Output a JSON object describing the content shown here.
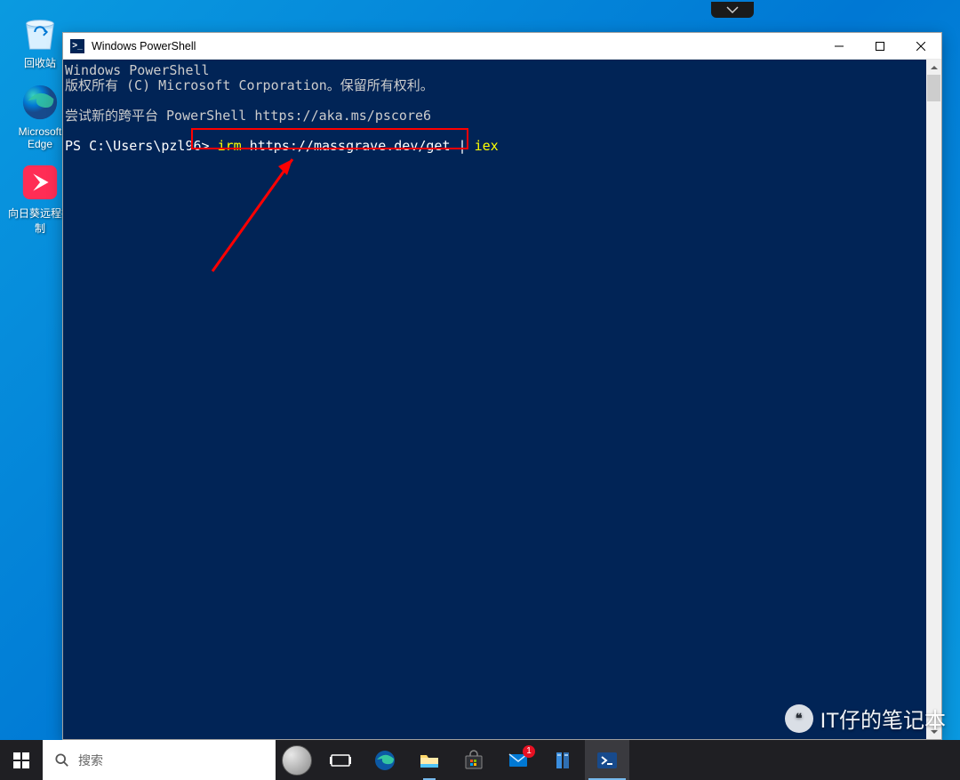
{
  "desktop": {
    "icons": [
      {
        "name": "recycle-bin",
        "label": "回收站"
      },
      {
        "name": "edge",
        "label": "Microsoft Edge"
      },
      {
        "name": "sunlogin",
        "label": "向日葵远程控制"
      }
    ]
  },
  "window": {
    "title": "Windows PowerShell",
    "titlebar_icon_text": ">_"
  },
  "terminal": {
    "line1": "Windows PowerShell",
    "line2": "版权所有 (C) Microsoft Corporation。保留所有权利。",
    "line3": "尝试新的跨平台 PowerShell https://aka.ms/pscore6",
    "prompt": "PS C:\\Users\\pzl96> ",
    "cmd_irm": "irm",
    "cmd_url": " https://massgrave.dev/get ",
    "cmd_pipe": "|",
    "cmd_iex": " iex"
  },
  "taskbar": {
    "search_placeholder": "搜索",
    "mail_badge": "1"
  },
  "watermark": {
    "text": "IT仔的笔记本"
  }
}
